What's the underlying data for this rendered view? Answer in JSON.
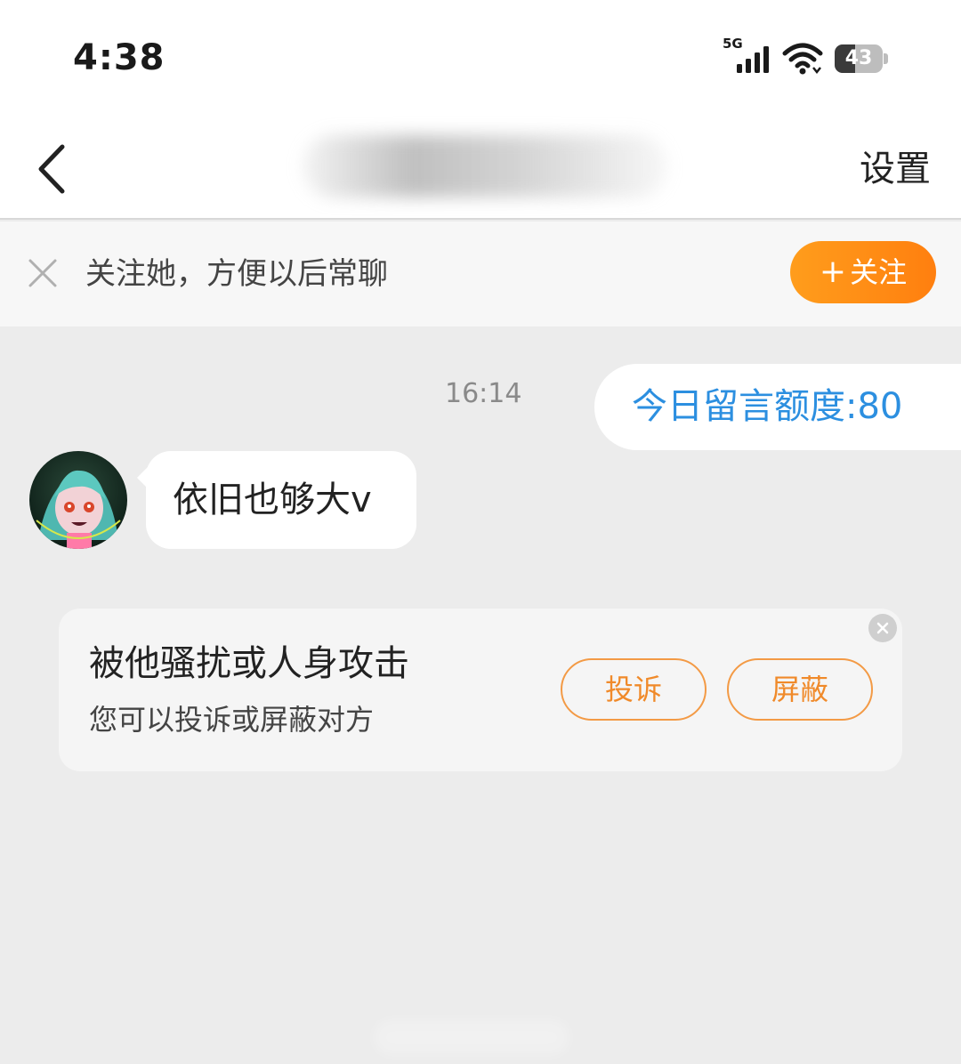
{
  "status_bar": {
    "time": "4:38",
    "network": "5G",
    "battery": "43",
    "battery_level": 0.43
  },
  "header": {
    "title": "",
    "settings_label": "设置"
  },
  "follow_banner": {
    "hint": "关注她，方便以后常聊",
    "follow_plus": "+",
    "follow_label": "关注",
    "accent_color": "#ff8a14"
  },
  "messages": {
    "timestamp": "16:14",
    "sent": "今日留言额度:80",
    "received": "依旧也够大v"
  },
  "safety_card": {
    "title": "被他骚扰或人身攻击",
    "subtitle": "您可以投诉或屏蔽对方",
    "complain_label": "投诉",
    "block_label": "屏蔽"
  },
  "icons": {
    "back": "chevron-left-icon",
    "close": "close-icon",
    "signal": "signal-icon",
    "wifi": "wifi-icon",
    "battery": "battery-icon"
  }
}
